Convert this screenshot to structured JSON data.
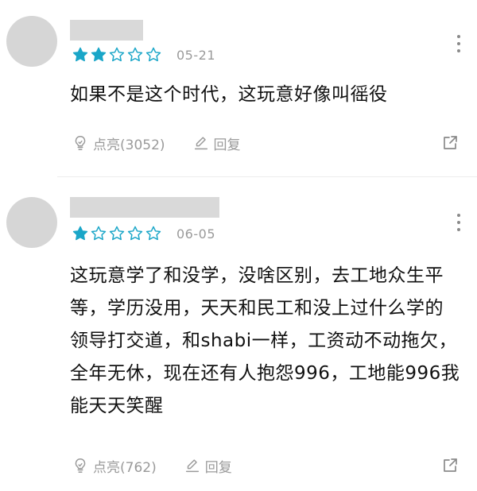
{
  "comments": [
    {
      "date": "05-21",
      "rating": 2,
      "text": "如果不是这个时代，这玩意好像叫徭役",
      "like_label": "点亮(3052)",
      "reply_label": "回复"
    },
    {
      "date": "06-05",
      "rating": 1,
      "text": "这玩意学了和没学，没啥区别，去工地众生平等，学历没用，天天和民工和没上过什么学的领导打交道，和shabi一样，工资动不动拖欠，全年无休，现在还有人抱怨996，工地能996我能天天笑醒",
      "like_label": "点亮(762)",
      "reply_label": "回复"
    }
  ],
  "colors": {
    "star": "#1aa6c8",
    "muted": "#9a9a9a",
    "avatar": "#d6d6d6"
  },
  "icons": {
    "like": "lightbulb-icon",
    "reply": "edit-icon",
    "share": "share-icon",
    "more": "more-vertical-icon"
  }
}
